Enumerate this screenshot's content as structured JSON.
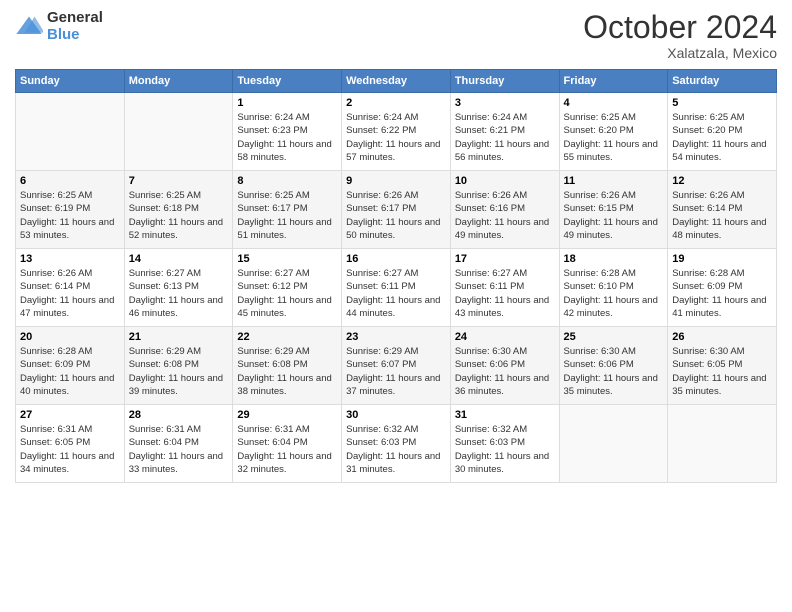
{
  "logo": {
    "general": "General",
    "blue": "Blue"
  },
  "header": {
    "title": "October 2024",
    "location": "Xalatzala, Mexico"
  },
  "columns": [
    "Sunday",
    "Monday",
    "Tuesday",
    "Wednesday",
    "Thursday",
    "Friday",
    "Saturday"
  ],
  "weeks": [
    [
      {
        "day": "",
        "sunrise": "",
        "sunset": "",
        "daylight": ""
      },
      {
        "day": "",
        "sunrise": "",
        "sunset": "",
        "daylight": ""
      },
      {
        "day": "1",
        "sunrise": "Sunrise: 6:24 AM",
        "sunset": "Sunset: 6:23 PM",
        "daylight": "Daylight: 11 hours and 58 minutes."
      },
      {
        "day": "2",
        "sunrise": "Sunrise: 6:24 AM",
        "sunset": "Sunset: 6:22 PM",
        "daylight": "Daylight: 11 hours and 57 minutes."
      },
      {
        "day": "3",
        "sunrise": "Sunrise: 6:24 AM",
        "sunset": "Sunset: 6:21 PM",
        "daylight": "Daylight: 11 hours and 56 minutes."
      },
      {
        "day": "4",
        "sunrise": "Sunrise: 6:25 AM",
        "sunset": "Sunset: 6:20 PM",
        "daylight": "Daylight: 11 hours and 55 minutes."
      },
      {
        "day": "5",
        "sunrise": "Sunrise: 6:25 AM",
        "sunset": "Sunset: 6:20 PM",
        "daylight": "Daylight: 11 hours and 54 minutes."
      }
    ],
    [
      {
        "day": "6",
        "sunrise": "Sunrise: 6:25 AM",
        "sunset": "Sunset: 6:19 PM",
        "daylight": "Daylight: 11 hours and 53 minutes."
      },
      {
        "day": "7",
        "sunrise": "Sunrise: 6:25 AM",
        "sunset": "Sunset: 6:18 PM",
        "daylight": "Daylight: 11 hours and 52 minutes."
      },
      {
        "day": "8",
        "sunrise": "Sunrise: 6:25 AM",
        "sunset": "Sunset: 6:17 PM",
        "daylight": "Daylight: 11 hours and 51 minutes."
      },
      {
        "day": "9",
        "sunrise": "Sunrise: 6:26 AM",
        "sunset": "Sunset: 6:17 PM",
        "daylight": "Daylight: 11 hours and 50 minutes."
      },
      {
        "day": "10",
        "sunrise": "Sunrise: 6:26 AM",
        "sunset": "Sunset: 6:16 PM",
        "daylight": "Daylight: 11 hours and 49 minutes."
      },
      {
        "day": "11",
        "sunrise": "Sunrise: 6:26 AM",
        "sunset": "Sunset: 6:15 PM",
        "daylight": "Daylight: 11 hours and 49 minutes."
      },
      {
        "day": "12",
        "sunrise": "Sunrise: 6:26 AM",
        "sunset": "Sunset: 6:14 PM",
        "daylight": "Daylight: 11 hours and 48 minutes."
      }
    ],
    [
      {
        "day": "13",
        "sunrise": "Sunrise: 6:26 AM",
        "sunset": "Sunset: 6:14 PM",
        "daylight": "Daylight: 11 hours and 47 minutes."
      },
      {
        "day": "14",
        "sunrise": "Sunrise: 6:27 AM",
        "sunset": "Sunset: 6:13 PM",
        "daylight": "Daylight: 11 hours and 46 minutes."
      },
      {
        "day": "15",
        "sunrise": "Sunrise: 6:27 AM",
        "sunset": "Sunset: 6:12 PM",
        "daylight": "Daylight: 11 hours and 45 minutes."
      },
      {
        "day": "16",
        "sunrise": "Sunrise: 6:27 AM",
        "sunset": "Sunset: 6:11 PM",
        "daylight": "Daylight: 11 hours and 44 minutes."
      },
      {
        "day": "17",
        "sunrise": "Sunrise: 6:27 AM",
        "sunset": "Sunset: 6:11 PM",
        "daylight": "Daylight: 11 hours and 43 minutes."
      },
      {
        "day": "18",
        "sunrise": "Sunrise: 6:28 AM",
        "sunset": "Sunset: 6:10 PM",
        "daylight": "Daylight: 11 hours and 42 minutes."
      },
      {
        "day": "19",
        "sunrise": "Sunrise: 6:28 AM",
        "sunset": "Sunset: 6:09 PM",
        "daylight": "Daylight: 11 hours and 41 minutes."
      }
    ],
    [
      {
        "day": "20",
        "sunrise": "Sunrise: 6:28 AM",
        "sunset": "Sunset: 6:09 PM",
        "daylight": "Daylight: 11 hours and 40 minutes."
      },
      {
        "day": "21",
        "sunrise": "Sunrise: 6:29 AM",
        "sunset": "Sunset: 6:08 PM",
        "daylight": "Daylight: 11 hours and 39 minutes."
      },
      {
        "day": "22",
        "sunrise": "Sunrise: 6:29 AM",
        "sunset": "Sunset: 6:08 PM",
        "daylight": "Daylight: 11 hours and 38 minutes."
      },
      {
        "day": "23",
        "sunrise": "Sunrise: 6:29 AM",
        "sunset": "Sunset: 6:07 PM",
        "daylight": "Daylight: 11 hours and 37 minutes."
      },
      {
        "day": "24",
        "sunrise": "Sunrise: 6:30 AM",
        "sunset": "Sunset: 6:06 PM",
        "daylight": "Daylight: 11 hours and 36 minutes."
      },
      {
        "day": "25",
        "sunrise": "Sunrise: 6:30 AM",
        "sunset": "Sunset: 6:06 PM",
        "daylight": "Daylight: 11 hours and 35 minutes."
      },
      {
        "day": "26",
        "sunrise": "Sunrise: 6:30 AM",
        "sunset": "Sunset: 6:05 PM",
        "daylight": "Daylight: 11 hours and 35 minutes."
      }
    ],
    [
      {
        "day": "27",
        "sunrise": "Sunrise: 6:31 AM",
        "sunset": "Sunset: 6:05 PM",
        "daylight": "Daylight: 11 hours and 34 minutes."
      },
      {
        "day": "28",
        "sunrise": "Sunrise: 6:31 AM",
        "sunset": "Sunset: 6:04 PM",
        "daylight": "Daylight: 11 hours and 33 minutes."
      },
      {
        "day": "29",
        "sunrise": "Sunrise: 6:31 AM",
        "sunset": "Sunset: 6:04 PM",
        "daylight": "Daylight: 11 hours and 32 minutes."
      },
      {
        "day": "30",
        "sunrise": "Sunrise: 6:32 AM",
        "sunset": "Sunset: 6:03 PM",
        "daylight": "Daylight: 11 hours and 31 minutes."
      },
      {
        "day": "31",
        "sunrise": "Sunrise: 6:32 AM",
        "sunset": "Sunset: 6:03 PM",
        "daylight": "Daylight: 11 hours and 30 minutes."
      },
      {
        "day": "",
        "sunrise": "",
        "sunset": "",
        "daylight": ""
      },
      {
        "day": "",
        "sunrise": "",
        "sunset": "",
        "daylight": ""
      }
    ]
  ]
}
